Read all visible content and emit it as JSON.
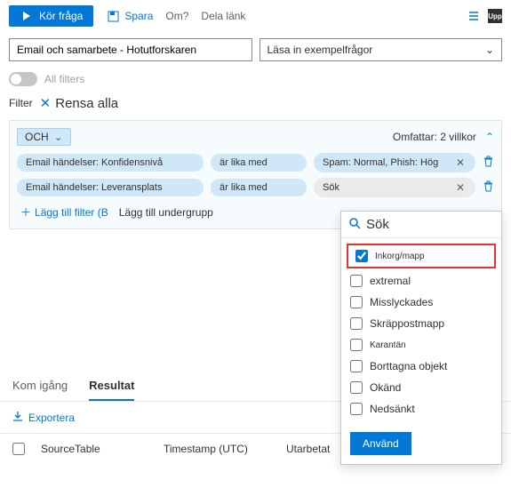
{
  "toolbar": {
    "run": "Kör fråga",
    "save": "Spara",
    "om": "Om?",
    "share": "Dela länk"
  },
  "inputs": {
    "query": "Email och samarbete - Hotutforskaren",
    "examples": "Läsa in exempelfrågor"
  },
  "allFilters": "All filters",
  "filterLabel": "Filter",
  "clearAll": "Rensa alla",
  "builder": {
    "and": "OCH",
    "scope": "Omfattar: 2 villkor",
    "rows": [
      {
        "field": "Email händelser: Konfidensnivå",
        "op": "är lika med",
        "val": "Spam: Normal, Phish: Hög"
      },
      {
        "field": "Email händelser: Leveransplats",
        "op": "är lika med",
        "val": "Sök"
      }
    ],
    "addFilter": "Lägg till filter (B",
    "addSubgroup": "Lägg till undergrupp"
  },
  "dropdown": {
    "search": "Sök",
    "items": [
      "Inkorg/mapp",
      "extremal",
      "Misslyckades",
      "Skräppostmapp",
      "Karantän",
      "Borttagna objekt",
      "Okänd",
      "Nedsänkt"
    ],
    "apply": "Använd"
  },
  "tabs": {
    "start": "Kom igång",
    "results": "Resultat"
  },
  "export": "Exportera",
  "table": {
    "c1": "SourceTable",
    "c2": "Timestamp (UTC)",
    "c3": "Utarbetat"
  }
}
